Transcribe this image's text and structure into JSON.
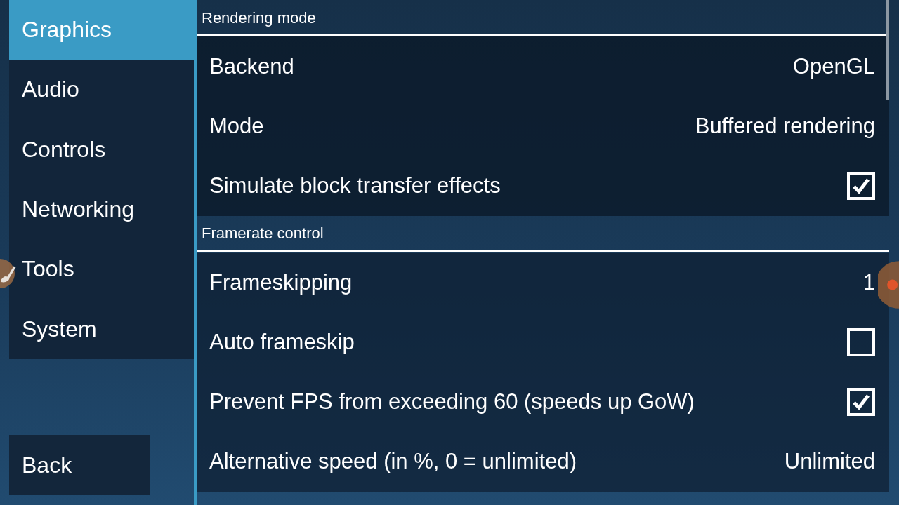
{
  "sidebar": {
    "tabs": [
      {
        "label": "Graphics",
        "selected": true
      },
      {
        "label": "Audio",
        "selected": false
      },
      {
        "label": "Controls",
        "selected": false
      },
      {
        "label": "Networking",
        "selected": false
      },
      {
        "label": "Tools",
        "selected": false
      },
      {
        "label": "System",
        "selected": false
      }
    ],
    "back_button": "Back"
  },
  "sections": [
    {
      "title": "Rendering mode",
      "items": [
        {
          "kind": "value",
          "label": "Backend",
          "value": "OpenGL"
        },
        {
          "kind": "value",
          "label": "Mode",
          "value": "Buffered rendering"
        },
        {
          "kind": "checkbox",
          "label": "Simulate block transfer effects",
          "checked": true
        }
      ]
    },
    {
      "title": "Framerate control",
      "items": [
        {
          "kind": "value",
          "label": "Frameskipping",
          "value": "1"
        },
        {
          "kind": "checkbox",
          "label": "Auto frameskip",
          "checked": false
        },
        {
          "kind": "checkbox",
          "label": "Prevent FPS from exceeding 60 (speeds up GoW)",
          "checked": true
        },
        {
          "kind": "value",
          "label": "Alternative speed (in %, 0 = unlimited)",
          "value": "Unlimited"
        }
      ]
    }
  ]
}
